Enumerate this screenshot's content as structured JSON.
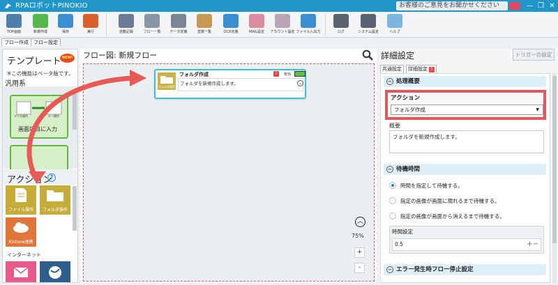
{
  "titlebar": {
    "title": "RPAロボットPINOKIO",
    "feedback": "お客様のご意見をお聞かせください",
    "minimize": "—",
    "maximize": "❐",
    "close": "✕"
  },
  "toolbar": {
    "items": [
      {
        "label": "TOP画面",
        "icon": "home-icon",
        "color": "#4b7fa8"
      },
      {
        "label": "新規作成",
        "icon": "new-icon",
        "color": "#55b84a"
      },
      {
        "label": "保存",
        "icon": "save-icon",
        "color": "#3b8fd0"
      },
      {
        "label": "実行",
        "icon": "run-icon",
        "color": "#d9602c"
      },
      {
        "label": "自動記録",
        "icon": "record-icon",
        "color": "#6d7a96"
      },
      {
        "label": "フロー一覧",
        "icon": "flow-list-icon",
        "color": "#8a96a6"
      },
      {
        "label": "データ定義",
        "icon": "data-icon",
        "color": "#7a8696"
      },
      {
        "label": "変数一覧",
        "icon": "variable-icon",
        "color": "#c79a54"
      },
      {
        "label": "OCR定義",
        "icon": "ocr-icon",
        "color": "#3b8fd0"
      },
      {
        "label": "MAIL設定",
        "icon": "mail-icon",
        "color": "#d78ca0"
      },
      {
        "label": "アカウント設定",
        "icon": "account-icon",
        "color": "#b6a6b6"
      },
      {
        "label": "ファイル入出力",
        "icon": "file-io-icon",
        "color": "#3b8fd0"
      },
      {
        "label": "ログ",
        "icon": "log-icon",
        "color": "#5a6470"
      },
      {
        "label": "システム設定",
        "icon": "settings-icon",
        "color": "#5a6470"
      },
      {
        "label": "ヘルプ",
        "icon": "help-icon",
        "color": "#7ab6e0"
      }
    ]
  },
  "tabs": {
    "flow_create": "フロー作成",
    "flow_settings": "フロー設定"
  },
  "left": {
    "template_title": "テンプレート",
    "new_badge": "NEW!",
    "beta_note": "※この機能はベータ版です。",
    "category": "汎用系",
    "template_card_label": "画面項目に入力",
    "template_sub_mouse": "マウス操作",
    "template_sub_key": "キー操作",
    "action_title": "アクション",
    "action_help": "?",
    "actions": [
      {
        "label": "ファイル操作",
        "icon": "file-icon",
        "color": "#c6ad3a"
      },
      {
        "label": "フォルダ操作",
        "icon": "folder-icon",
        "color": "#c6ad3a"
      },
      {
        "label": "Kintone連携",
        "icon": "cloud-icon",
        "color": "#e0773a"
      }
    ],
    "internet_category": "インターネット",
    "internet_tiles": [
      {
        "icon": "mail-icon",
        "color": "#e85a8a"
      },
      {
        "icon": "globe-icon",
        "color": "#2d5e8c"
      }
    ]
  },
  "center": {
    "title": "フロー図:  新規フロー",
    "node": {
      "title": "フォルダ作成",
      "icon_caption": "フォルダ操作",
      "description": "フォルダを新規作成します。",
      "warning": "!",
      "enabled_label": "有効"
    },
    "zoom": "75%",
    "zoom_in": "+",
    "zoom_out": "-"
  },
  "right": {
    "title": "詳細設定",
    "trigger_button": "トリガーの設定",
    "tab_common": "共通設定",
    "tab_detail": "詳細設定",
    "tab_warning": "!",
    "section_overview": "処理概要",
    "action_label": "アクション",
    "action_value": "フォルダ作成",
    "overview_label": "概要",
    "overview_text": "フォルダを新規作成します。",
    "section_wait": "待機時間",
    "wait_options": [
      {
        "label": "時間を指定して待機する。",
        "selected": true
      },
      {
        "label": "指定の画像が画面に現れるまで待機する。",
        "selected": false
      },
      {
        "label": "指定の画像が画面から消えるまで待機する。",
        "selected": false
      }
    ],
    "time_label": "時間設定",
    "time_value": "0.5",
    "section_error": "エラー発生時フロー停止設定",
    "collapse_symbol": "−"
  },
  "colors": {
    "titlebar": "#1f95c8",
    "highlight": "#e4575c",
    "node_border": "#39c4d6",
    "section_head": "#dfeff8"
  }
}
